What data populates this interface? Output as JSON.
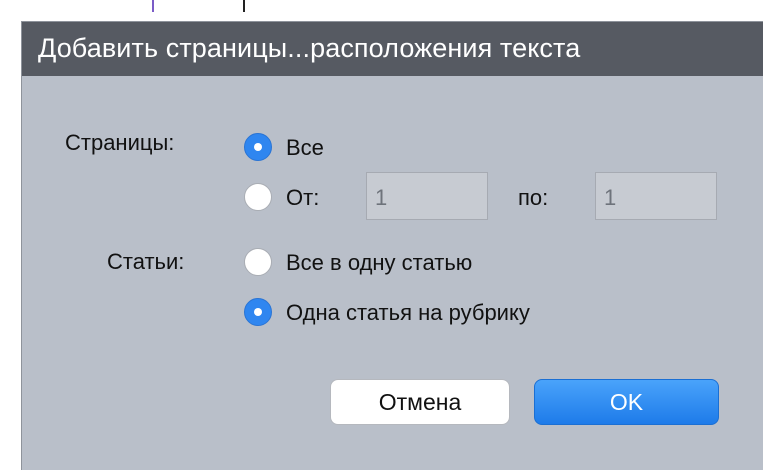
{
  "dialog": {
    "title": "Добавить страницы...расположения текста",
    "pages": {
      "label": "Страницы:",
      "all_label": "Все",
      "from_label": "От:",
      "from_value": "1",
      "to_label": "по:",
      "to_value": "1",
      "selected": "all"
    },
    "articles": {
      "label": "Статьи:",
      "one_article_label": "Все в одну статью",
      "per_rubric_label": "Одна статья на рубрику",
      "selected": "per_rubric"
    },
    "buttons": {
      "cancel": "Отмена",
      "ok": "OK"
    }
  },
  "colors": {
    "accent": "#2f86f0",
    "dialog_bg": "#b9bfc9",
    "titlebar_bg": "#565a62"
  }
}
